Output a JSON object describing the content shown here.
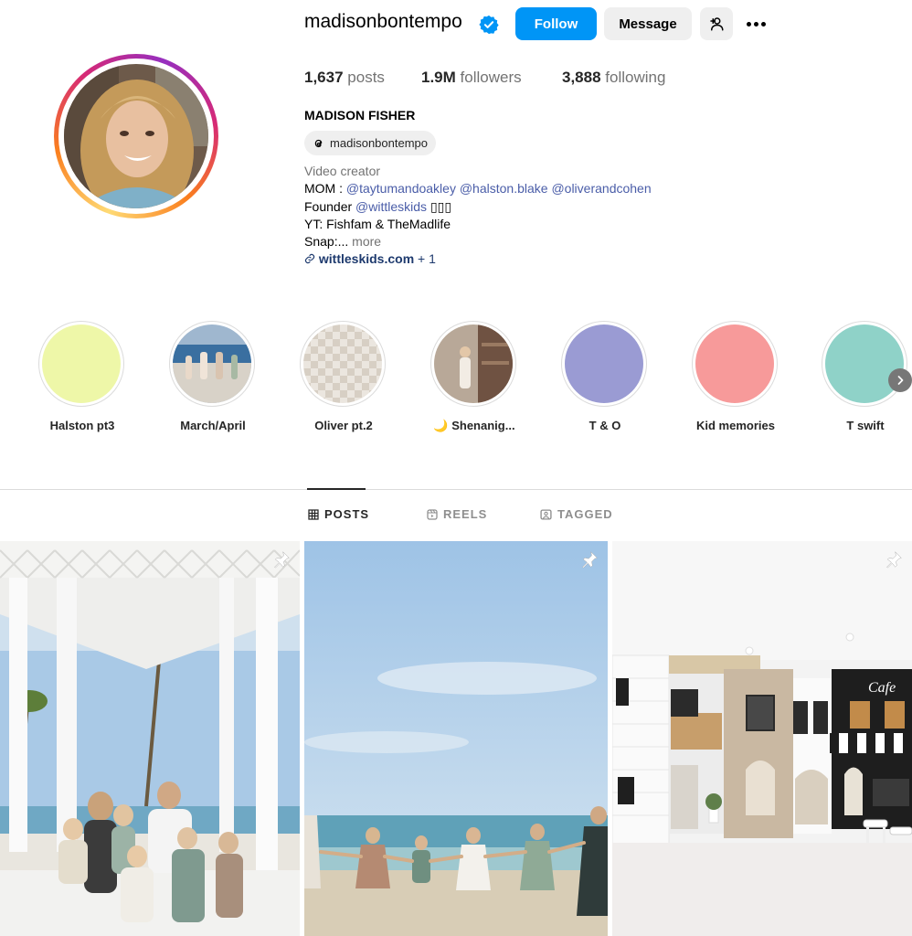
{
  "profile": {
    "username": "madisonbontempo",
    "full_name": "MADISON FISHER",
    "verified": true,
    "threads_handle": "madisonbontempo",
    "follow_label": "Follow",
    "message_label": "Message",
    "stats": {
      "posts_value": "1,637",
      "posts_label": "posts",
      "followers_value": "1.9M",
      "followers_label": "followers",
      "following_value": "3,888",
      "following_label": "following"
    },
    "bio": {
      "category": "Video creator",
      "line1_prefix": "MOM : ",
      "line1_tags": [
        "@taytumandoakley",
        "@halston.blake",
        "@oliverandcohen"
      ],
      "line2_prefix": "Founder ",
      "line2_tag": "@wittleskids",
      "line2_suffix": " ▯▯▯",
      "line3": "YT: Fishfam & TheMadlife",
      "line4": "Snap:...",
      "more_label": "more",
      "link": "wittleskids.com",
      "link_extra": " + 1"
    }
  },
  "highlights": [
    {
      "label": "Halston pt3",
      "color": "#eef7a8"
    },
    {
      "label": "March/April",
      "color": "#6f8fb0"
    },
    {
      "label": "Oliver pt.2",
      "color": "#e6e0d8"
    },
    {
      "label": "🌙 Shenanig...",
      "color": "#8a7060"
    },
    {
      "label": "T & O",
      "color": "#9a9bd3"
    },
    {
      "label": "Kid memories",
      "color": "#f79a9a"
    },
    {
      "label": "T swift",
      "color": "#8fd2c8"
    }
  ],
  "tabs": [
    {
      "label": "POSTS",
      "active": true
    },
    {
      "label": "REELS",
      "active": false
    },
    {
      "label": "TAGGED",
      "active": false
    }
  ],
  "posts": [
    {
      "subject": "family-in-white-gazebo-by-the-sea",
      "pinned": true
    },
    {
      "subject": "children-holding-hands-on-beach",
      "pinned": true
    },
    {
      "subject": "indoor-playhouse-with-cafe-front",
      "pinned": true
    }
  ],
  "colors": {
    "accent": "#0095f6",
    "verified": "#0095f6",
    "link": "#4a5da8"
  }
}
